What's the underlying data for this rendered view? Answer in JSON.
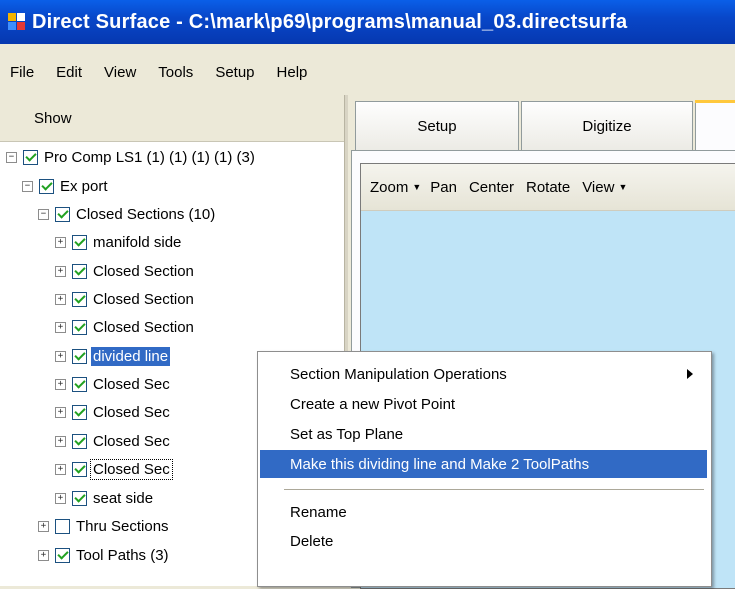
{
  "window": {
    "title": "Direct Surface - C:\\mark\\p69\\programs\\manual_03.directsurfa"
  },
  "menu": [
    "File",
    "Edit",
    "View",
    "Tools",
    "Setup",
    "Help"
  ],
  "left_panel": {
    "header": "Show"
  },
  "tree": [
    {
      "label": "Pro Comp LS1 (1) (1) (1) (1) (3)",
      "expander": "−",
      "checked": true
    },
    {
      "label": "Ex port",
      "expander": "−",
      "checked": true
    },
    {
      "label": "Closed Sections (10)",
      "expander": "−",
      "checked": true
    },
    {
      "label": "manifold side",
      "expander": "+",
      "checked": true
    },
    {
      "label": "Closed Section",
      "expander": "+",
      "checked": true
    },
    {
      "label": "Closed Section",
      "expander": "+",
      "checked": true
    },
    {
      "label": "Closed Section",
      "expander": "+",
      "checked": true
    },
    {
      "label": "divided line",
      "expander": "+",
      "checked": true,
      "selected": true
    },
    {
      "label": "Closed Sec",
      "expander": "+",
      "checked": true
    },
    {
      "label": "Closed Sec",
      "expander": "+",
      "checked": true
    },
    {
      "label": "Closed Sec",
      "expander": "+",
      "checked": true
    },
    {
      "label": "Closed Sec",
      "expander": "+",
      "checked": true,
      "focused": true
    },
    {
      "label": "seat side",
      "expander": "+",
      "checked": true
    },
    {
      "label": "Thru Sections",
      "expander": "+",
      "checked": false
    },
    {
      "label": "Tool Paths (3)",
      "expander": "+",
      "checked": true
    }
  ],
  "tabs": [
    "Setup",
    "Digitize"
  ],
  "toolbar": {
    "zoom": "Zoom",
    "pan": "Pan",
    "center": "Center",
    "rotate": "Rotate",
    "view": "View"
  },
  "context_menu": {
    "items": [
      {
        "label": "Section Manipulation Operations",
        "submenu": true
      },
      {
        "label": "Create a new Pivot Point"
      },
      {
        "label": "Set as Top Plane"
      },
      {
        "label": "Make this dividing line and Make 2 ToolPaths",
        "highlighted": true
      },
      {
        "label": "Rename"
      },
      {
        "label": "Delete"
      }
    ]
  },
  "colors": {
    "title_bar": "#0847c9",
    "selection": "#316ac5",
    "viewport": "#bfe4f7",
    "check": "#21a121",
    "active_tab_edge": "#ffc83c"
  },
  "icons": [
    "app-icon",
    "checkbox-checked-icon",
    "expand-plus-icon",
    "collapse-minus-icon",
    "dropdown-caret-icon",
    "submenu-arrow-icon"
  ]
}
